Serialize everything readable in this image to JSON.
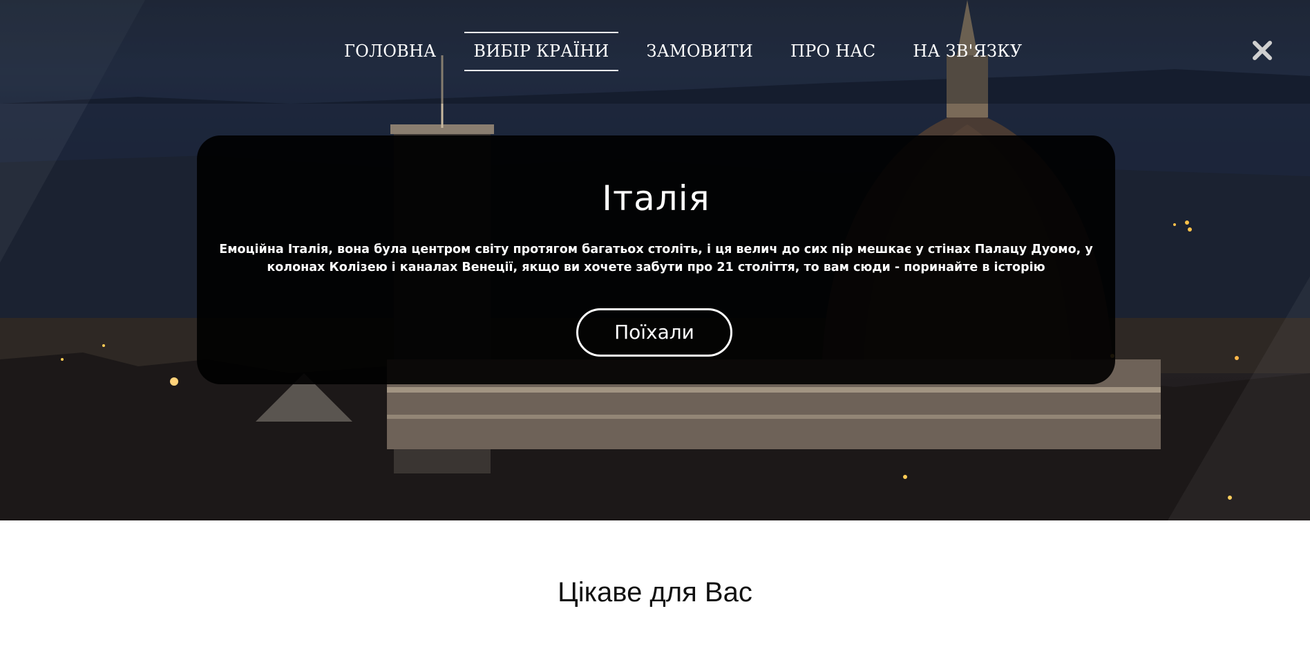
{
  "nav": {
    "items": [
      {
        "label": "ГОЛОВНА"
      },
      {
        "label": "ВИБІР КРАЇНИ"
      },
      {
        "label": "ЗАМОВИТИ"
      },
      {
        "label": "ПРО НАС"
      },
      {
        "label": "НА ЗВ'ЯЗКУ"
      }
    ],
    "active_index": 1,
    "close_icon": "close-icon"
  },
  "hero": {
    "background": "night-city-florence-duomo",
    "title": "Італія",
    "description": "Емоційна Італія, вона була центром світу протягом багатьох століть, і ця велич до сих пір мешкає у стінах Палацу Дуомо, у колонах Колізею і каналах Венеції, якщо ви хочете забути про 21 століття, то вам сюди - поринайте в історію",
    "button_label": "Поїхали"
  },
  "section": {
    "title": "Цікаве для Вас"
  },
  "colors": {
    "card_background": "#000000",
    "text": "#ffffff",
    "page_background": "#ffffff"
  }
}
